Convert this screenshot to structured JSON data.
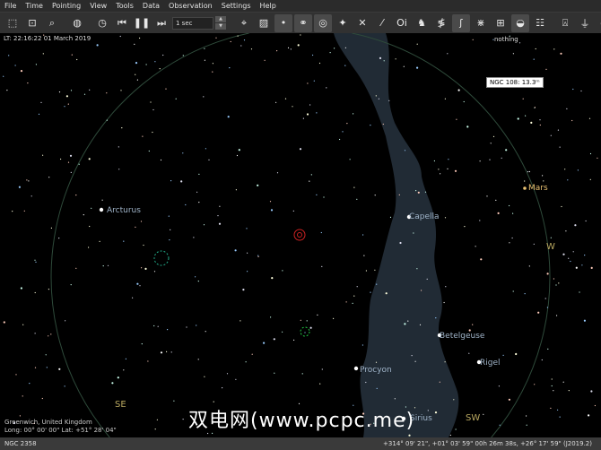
{
  "menu": [
    "File",
    "Time",
    "Pointing",
    "View",
    "Tools",
    "Data",
    "Observation",
    "Settings",
    "Help"
  ],
  "toolbar": {
    "time_step": "1 sec",
    "icons": [
      "zoom-box-icon",
      "zoom-fit-icon",
      "search-icon",
      "globe-icon",
      "clock-icon",
      "step-back-icon",
      "pause-icon",
      "step-forward-icon",
      "crosshair-icon",
      "image-icon",
      "stars-icon",
      "deep-sky-icon",
      "solar-system-icon",
      "supernova-icon",
      "constellation-lines-icon",
      "asterism-icon",
      "constellation-names-icon",
      "constellation-art-icon",
      "constellation-boundaries-icon",
      "milky-way-icon",
      "equatorial-grid-icon",
      "horizontal-grid-icon",
      "ground-icon",
      "flags-icon",
      "telescope-icon",
      "observing-list-icon",
      "galaxy-icon",
      "export-icon"
    ]
  },
  "sky": {
    "local_time": "LT: 22:16:22   01 March 2019",
    "focus": "nothing",
    "tooltip": "NGC 108: 13.3ᵐ",
    "location": "Greenwich, United Kingdom",
    "coords": "Long:  00° 00' 00\"  Lat:  +51° 28' 04\"",
    "watermark": "双电网(www.pcpc.me)",
    "objects": [
      "Arcturus",
      "Capella",
      "Mars",
      "Betelgeuse",
      "Rigel",
      "Procyon",
      "Sirius"
    ],
    "horizon": [
      "W",
      "SE",
      "SW"
    ]
  },
  "status": {
    "object": "NGC 2358",
    "position": "+314° 09' 21\", +01° 03' 59\"   00h 26m 38s, +26° 17' 59\" (J2019.2)"
  }
}
